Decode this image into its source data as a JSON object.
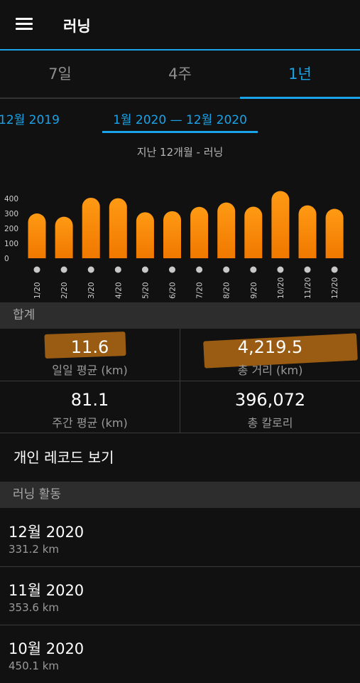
{
  "header": {
    "title": "러닝"
  },
  "tabs": [
    {
      "label": "7일"
    },
    {
      "label": "4주"
    },
    {
      "label": "1년"
    }
  ],
  "period": {
    "previous": "12월 2019",
    "current": "1월 2020 — 12월 2020"
  },
  "chart_caption": "지난 12개월 - 러닝",
  "chart_data": {
    "type": "bar",
    "categories": [
      "1/20",
      "2/20",
      "3/20",
      "4/20",
      "5/20",
      "6/20",
      "7/20",
      "8/20",
      "9/20",
      "10/20",
      "11/20",
      "12/20"
    ],
    "values": [
      300,
      278,
      405,
      402,
      308,
      315,
      344,
      373,
      345,
      450,
      354,
      331
    ],
    "yticks": [
      0,
      100,
      200,
      300,
      400
    ],
    "ylim": [
      0,
      450
    ],
    "bar_color_top": "#ff9a14",
    "bar_color_bottom": "#f07800",
    "grid": false
  },
  "summary": {
    "header": "합계",
    "daily_avg": {
      "value": "11.6",
      "label": "일일 평균 (km)"
    },
    "total_distance": {
      "value": "4,219.5",
      "label": "총 거리 (km)"
    },
    "weekly_avg": {
      "value": "81.1",
      "label": "주간 평균 (km)"
    },
    "total_calories": {
      "value": "396,072",
      "label": "총 칼로리"
    }
  },
  "records_link": "개인 레코드 보기",
  "activities": {
    "header": "러닝 활동",
    "items": [
      {
        "month": "12월 2020",
        "distance": "331.2 km"
      },
      {
        "month": "11월 2020",
        "distance": "353.6 km"
      },
      {
        "month": "10월 2020",
        "distance": "450.1 km"
      }
    ]
  },
  "colors": {
    "accent": "#1aa3e8",
    "highlight": "#c87614"
  }
}
